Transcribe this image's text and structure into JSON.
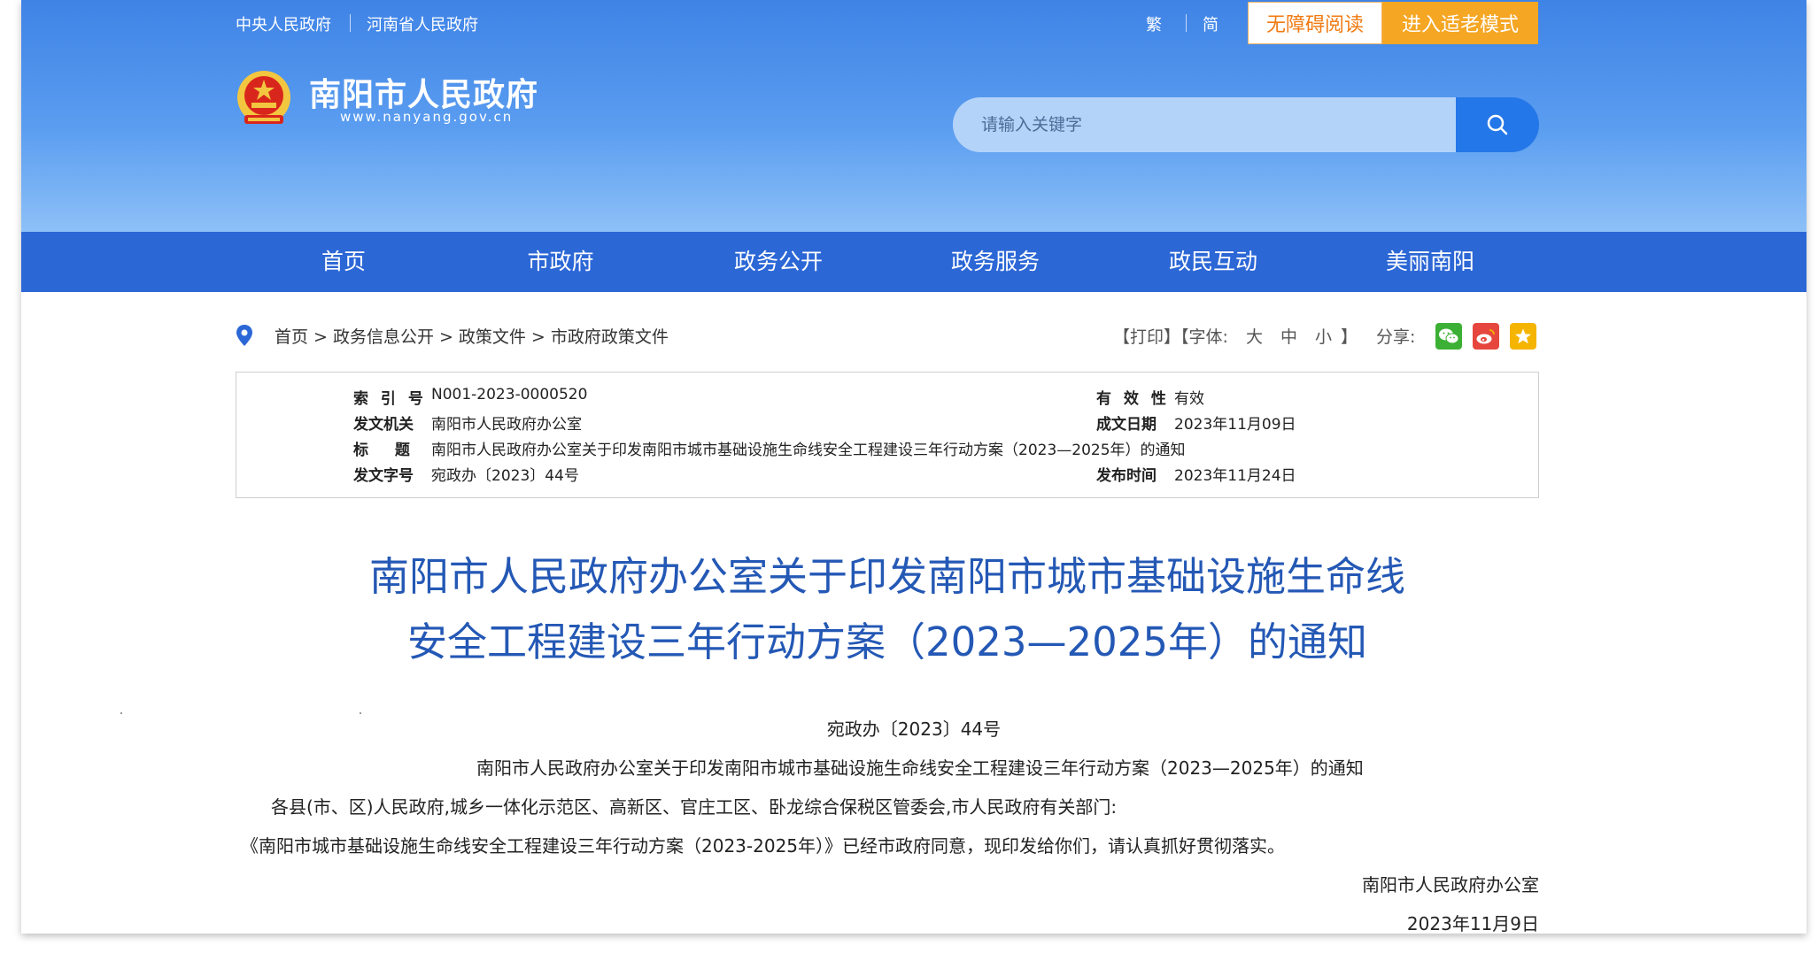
{
  "header": {
    "top_links": [
      "中央人民政府",
      "河南省人民政府"
    ],
    "lang": [
      "繁",
      "简"
    ],
    "access_button": "无障碍阅读",
    "elder_button": "进入适老模式",
    "site_name": "南阳市人民政府",
    "site_url": "www.nanyang.gov.cn",
    "search_placeholder": "请输入关键字"
  },
  "nav": {
    "items": [
      {
        "label": "首页"
      },
      {
        "label": "市政府"
      },
      {
        "label": "政务公开"
      },
      {
        "label": "政务服务"
      },
      {
        "label": "政民互动"
      },
      {
        "label": "美丽南阳"
      }
    ]
  },
  "breadcrumb": {
    "items": [
      "首页",
      "政务信息公开",
      "政策文件",
      "市政府政策文件"
    ],
    "separator": ">"
  },
  "tools": {
    "print": "【打印】",
    "font_prefix": "【字体:",
    "large": "大",
    "medium": "中",
    "small": "小",
    "font_suffix": "】",
    "share_label": "分享:"
  },
  "info": {
    "index_label": "索 引 号",
    "index_value": "N001-2023-0000520",
    "validity_label": "有 效 性",
    "validity_value": "有效",
    "issuer_label": "发文机关",
    "issuer_value": "南阳市人民政府办公室",
    "date_made_label": "成文日期",
    "date_made_value": "2023年11月09日",
    "title_label": "标 题",
    "title_value": "南阳市人民政府办公室关于印发南阳市城市基础设施生命线安全工程建设三年行动方案（2023—2025年）的通知",
    "docno_label": "发文字号",
    "docno_value": "宛政办〔2023〕44号",
    "publish_label": "发布时间",
    "publish_value": "2023年11月24日"
  },
  "document": {
    "title_line1": "南阳市人民政府办公室关于印发南阳市城市基础设施生命线",
    "title_line2": "安全工程建设三年行动方案（2023—2025年）的通知",
    "doc_no": "宛政办〔2023〕44号",
    "subtitle": "南阳市人民政府办公室关于印发南阳市城市基础设施生命线安全工程建设三年行动方案（2023—2025年）的通知",
    "addressee": "各县(市、区)人民政府,城乡一体化示范区、高新区、官庄工区、卧龙综合保税区管委会,市人民政府有关部门:",
    "body": "《南阳市城市基础设施生命线安全工程建设三年行动方案（2023-2025年）》已经市政府同意，现印发给你们，请认真抓好贯彻落实。",
    "signature": "南阳市人民政府办公室",
    "date": "2023年11月9日"
  },
  "colors": {
    "header_blue": "#3f83e6",
    "nav_blue": "#2c67d6",
    "title_blue": "#2458b5",
    "elder_orange": "#f5a623",
    "access_orange": "#f07b13",
    "wechat_green": "#3cb034",
    "weibo_red": "#e6463e",
    "fav_yellow": "#f4b400"
  },
  "icons": [
    "emblem",
    "search-icon",
    "location-pin-icon",
    "wechat-icon",
    "weibo-icon",
    "star-icon"
  ]
}
